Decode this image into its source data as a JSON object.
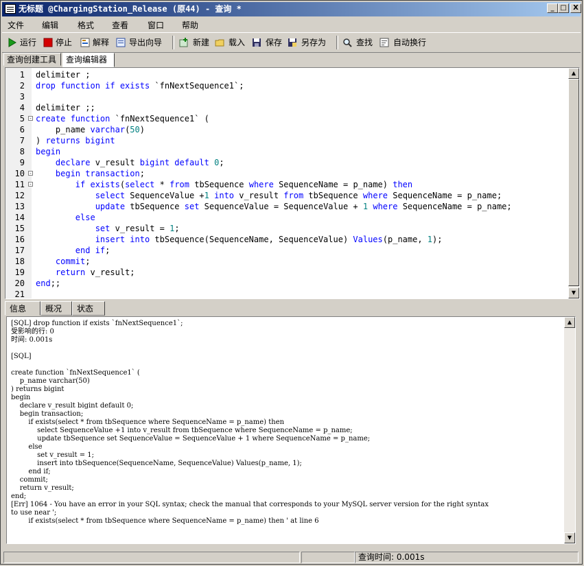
{
  "window": {
    "title": "无标题 @ChargingStation_Release (原44) - 查询 *",
    "controls": [
      "_",
      "□",
      "X"
    ]
  },
  "menu": [
    "文件",
    "编辑",
    "格式",
    "查看",
    "窗口",
    "帮助"
  ],
  "toolbar": {
    "run": "运行",
    "stop": "停止",
    "explain": "解释",
    "export_wizard": "导出向导",
    "new": "新建",
    "load": "载入",
    "save": "保存",
    "save_as": "另存为",
    "find": "查找",
    "word_wrap": "自动换行"
  },
  "top_tabs": [
    "查询创建工具",
    "查询编辑器"
  ],
  "bottom_tabs": [
    "信息",
    "概况",
    "状态"
  ],
  "editor": {
    "lines": [
      {
        "n": "1",
        "fold": "",
        "html": "delimiter ;"
      },
      {
        "n": "2",
        "fold": "",
        "html": "<span class='kw'>drop function if exists</span> `fnNextSequence1`;"
      },
      {
        "n": "3",
        "fold": "",
        "html": ""
      },
      {
        "n": "4",
        "fold": "",
        "html": "delimiter ;;"
      },
      {
        "n": "5",
        "fold": "-",
        "html": "<span class='kw'>create function</span> `fnNextSequence1` ("
      },
      {
        "n": "6",
        "fold": "",
        "html": "    p_name <span class='kw'>varchar</span>(<span class='num'>50</span>)"
      },
      {
        "n": "7",
        "fold": "",
        "html": ") <span class='kw'>returns bigint</span>"
      },
      {
        "n": "8",
        "fold": "",
        "html": "<span class='kw'>begin</span>"
      },
      {
        "n": "9",
        "fold": "",
        "html": "    <span class='kw'>declare</span> v_result <span class='kw'>bigint default</span> <span class='num'>0</span>;"
      },
      {
        "n": "10",
        "fold": "-",
        "html": "    <span class='kw'>begin transaction</span>;"
      },
      {
        "n": "11",
        "fold": "-",
        "html": "        <span class='kw'>if exists</span>(<span class='kw'>select</span> * <span class='kw'>from</span> tbSequence <span class='kw'>where</span> SequenceName = p_name) <span class='kw'>then</span>"
      },
      {
        "n": "12",
        "fold": "",
        "html": "            <span class='kw'>select</span> SequenceValue +<span class='num'>1</span> <span class='kw'>into</span> v_result <span class='kw'>from</span> tbSequence <span class='kw'>where</span> SequenceName = p_name;"
      },
      {
        "n": "13",
        "fold": "",
        "html": "            <span class='kw'>update</span> tbSequence <span class='kw'>set</span> SequenceValue = SequenceValue + <span class='num'>1</span> <span class='kw'>where</span> SequenceName = p_name;"
      },
      {
        "n": "14",
        "fold": "",
        "html": "        <span class='kw'>else</span>"
      },
      {
        "n": "15",
        "fold": "",
        "html": "            <span class='kw'>set</span> v_result = <span class='num'>1</span>;"
      },
      {
        "n": "16",
        "fold": "",
        "html": "            <span class='kw'>insert into</span> tbSequence(SequenceName, SequenceValue) <span class='kw'>Values</span>(p_name, <span class='num'>1</span>);"
      },
      {
        "n": "17",
        "fold": "",
        "html": "        <span class='kw'>end if</span>;"
      },
      {
        "n": "18",
        "fold": "",
        "html": "    <span class='kw'>commit</span>;"
      },
      {
        "n": "19",
        "fold": "",
        "html": "    <span class='kw'>return</span> v_result;"
      },
      {
        "n": "20",
        "fold": "",
        "html": "<span class='kw'>end</span>;;"
      },
      {
        "n": "21",
        "fold": "",
        "html": ""
      }
    ]
  },
  "output": {
    "text": "[SQL] drop function if exists `fnNextSequence1`;\n受影响的行: 0\n时间: 0.001s\n\n[SQL]\n\ncreate function `fnNextSequence1` (\n    p_name varchar(50)\n) returns bigint\nbegin\n    declare v_result bigint default 0;\n    begin transaction;\n        if exists(select * from tbSequence where SequenceName = p_name) then\n            select SequenceValue +1 into v_result from tbSequence where SequenceName = p_name;\n            update tbSequence set SequenceValue = SequenceValue + 1 where SequenceName = p_name;\n        else\n            set v_result = 1;\n            insert into tbSequence(SequenceName, SequenceValue) Values(p_name, 1);\n        end if;\n    commit;\n    return v_result;\nend;\n[Err] 1064 - You have an error in your SQL syntax; check the manual that corresponds to your MySQL server version for the right syntax\nto use near ';\n        if exists(select * from tbSequence where SequenceName = p_name) then ' at line 6"
  },
  "status": {
    "query_time": "查询时间: 0.001s"
  },
  "colors": {
    "keyword": "#0000ff",
    "number": "#008080",
    "title_start": "#0a246a",
    "title_end": "#a6caf0"
  }
}
